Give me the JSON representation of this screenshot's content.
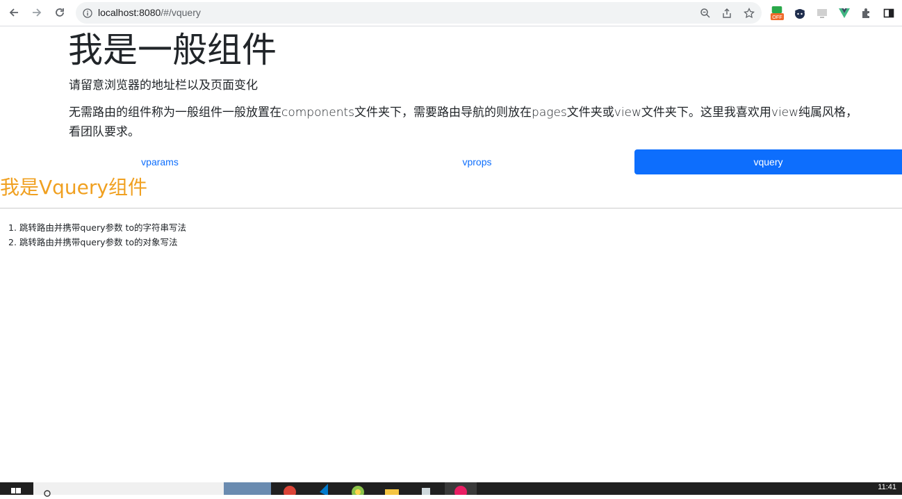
{
  "browser": {
    "url_host": "localhost:8080",
    "url_path": "/#/vquery"
  },
  "page": {
    "title": "我是一般组件",
    "lead1": "请留意浏览器的地址栏以及页面变化",
    "lead2": "无需路由的组件称为一般组件一般放置在components文件夹下，需要路由导航的则放在pages文件夹或view文件夹下。这里我喜欢用view纯属风格，看团队要求。"
  },
  "tabs": [
    {
      "label": "vparams",
      "active": false
    },
    {
      "label": "vprops",
      "active": false
    },
    {
      "label": "vquery",
      "active": true
    }
  ],
  "vquery": {
    "title": "我是Vquery组件",
    "items": [
      "1. 跳转路由并携带query参数 to的字符串写法",
      "2. 跳转路由并携带query参数 to的对象写法"
    ]
  },
  "taskbar": {
    "clock": "11:41"
  },
  "colors": {
    "accent": "#0d6efd",
    "vquery_title": "#f0a020"
  }
}
